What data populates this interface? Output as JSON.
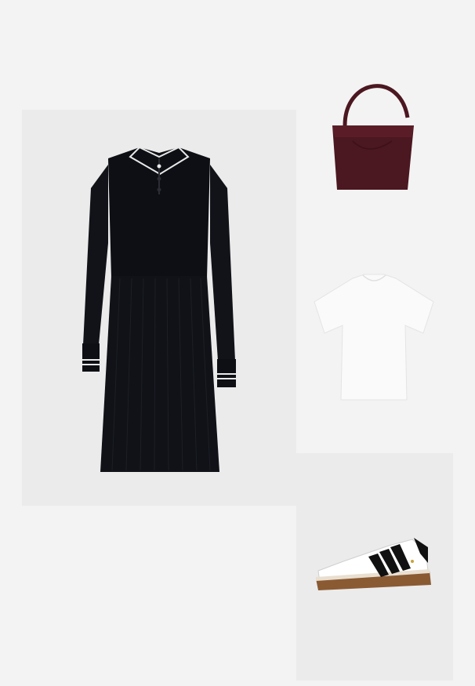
{
  "outfit": {
    "items": [
      {
        "item": "dress",
        "icon": "polo-dress-image",
        "colors": {
          "main": "#0d0f14",
          "trim": "#e8e8e8"
        }
      },
      {
        "item": "bag",
        "icon": "shoulder-bag-image",
        "colors": {
          "main": "#4b1720"
        }
      },
      {
        "item": "tshirt",
        "icon": "tshirt-image",
        "colors": {
          "main": "#fafafa"
        }
      },
      {
        "item": "sneaker",
        "icon": "sneaker-image",
        "colors": {
          "main": "#ffffff",
          "stripes": "#111111",
          "sole": "#8a5a33"
        }
      }
    ]
  }
}
